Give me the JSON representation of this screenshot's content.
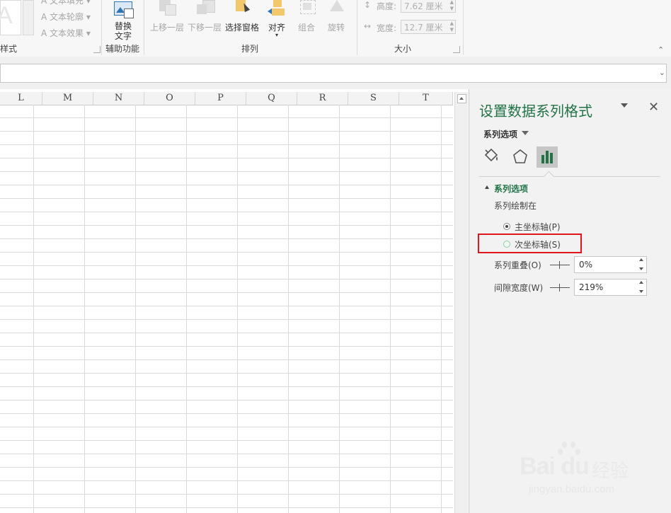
{
  "ribbon": {
    "wordart_styles": {
      "text_fill": "文本填充",
      "text_outline": "文本轮廓",
      "text_effects": "文本效果",
      "group_label": "样式"
    },
    "accessibility": {
      "alt_text_line1": "替换",
      "alt_text_line2": "文字",
      "group_label": "辅助功能"
    },
    "arrange": {
      "bring_forward": "上移一层",
      "send_backward": "下移一层",
      "selection_pane": "选择窗格",
      "align": "对齐",
      "group": "组合",
      "rotate": "旋转",
      "group_label": "排列"
    },
    "size": {
      "height_label": "高度:",
      "height_value": "7.62 厘米",
      "width_label": "宽度:",
      "width_value": "12.7 厘米",
      "group_label": "大小"
    }
  },
  "sheet": {
    "columns": [
      "L",
      "M",
      "N",
      "O",
      "P",
      "Q",
      "R",
      "S",
      "T"
    ]
  },
  "pane": {
    "title": "设置数据系列格式",
    "options_dropdown": "系列选项",
    "section_header": "系列选项",
    "plot_series_on": "系列绘制在",
    "primary_axis": "主坐标轴(P)",
    "secondary_axis": "次坐标轴(S)",
    "series_overlap_label": "系列重叠(O)",
    "series_overlap_value": "0%",
    "gap_width_label": "间隙宽度(W)",
    "gap_width_value": "219%",
    "selected_axis": "primary"
  },
  "watermark": {
    "brand": "Bai du",
    "cn": "经验",
    "url": "jingyan.baidu.com"
  },
  "colors": {
    "accent_green": "#217346",
    "highlight_red": "#e1161c"
  }
}
